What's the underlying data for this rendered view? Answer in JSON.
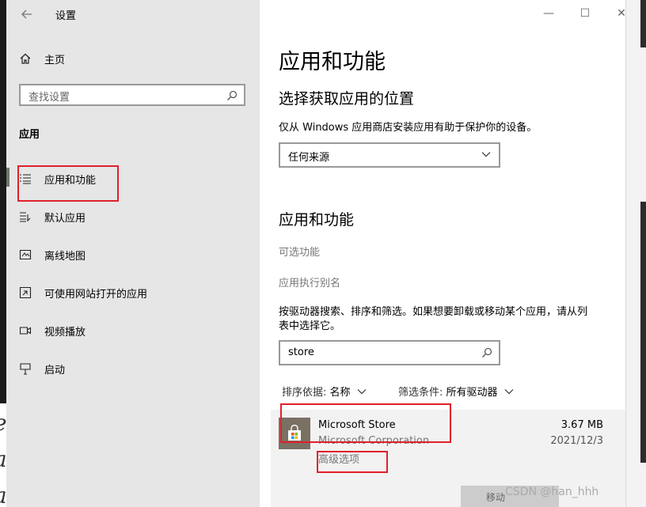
{
  "window": {
    "title": "设置",
    "controls": {
      "minimize": "—",
      "maximize": "☐",
      "close": "✕"
    }
  },
  "sidebar": {
    "home_label": "主页",
    "search_placeholder": "查找设置",
    "section_label": "应用",
    "items": [
      {
        "label": "应用和功能",
        "icon": "apps-list-icon",
        "selected": true
      },
      {
        "label": "默认应用",
        "icon": "default-apps-icon"
      },
      {
        "label": "离线地图",
        "icon": "offline-maps-icon"
      },
      {
        "label": "可使用网站打开的应用",
        "icon": "apps-for-websites-icon"
      },
      {
        "label": "视频播放",
        "icon": "video-playback-icon"
      },
      {
        "label": "启动",
        "icon": "startup-icon"
      }
    ]
  },
  "content": {
    "page_title": "应用和功能",
    "install_section": {
      "heading": "选择获取应用的位置",
      "description": "仅从 Windows 应用商店安装应用有助于保护你的设备。",
      "dropdown_value": "任何来源"
    },
    "apps_section": {
      "heading": "应用和功能",
      "link_optional": "可选功能",
      "link_alias": "应用执行别名",
      "description_line1": "按驱动器搜索、排序和筛选。如果想要卸载或移动某个应用，请从列",
      "description_line2": "表中选择它。",
      "search_value": "store",
      "sort_label": "排序依据:",
      "sort_value": "名称",
      "filter_label": "筛选条件:",
      "filter_value": "所有驱动器"
    },
    "app_item": {
      "name": "Microsoft Store",
      "publisher": "Microsoft Corporation",
      "advanced_link": "高级选项",
      "size": "3.67 MB",
      "date": "2021/12/3",
      "move_button": "移动"
    }
  },
  "watermark": "CSDN @han_hhh",
  "colors": {
    "sidebar_bg": "#e6e6e6",
    "highlight_box": "#e0202a",
    "link_gray": "#767676"
  }
}
